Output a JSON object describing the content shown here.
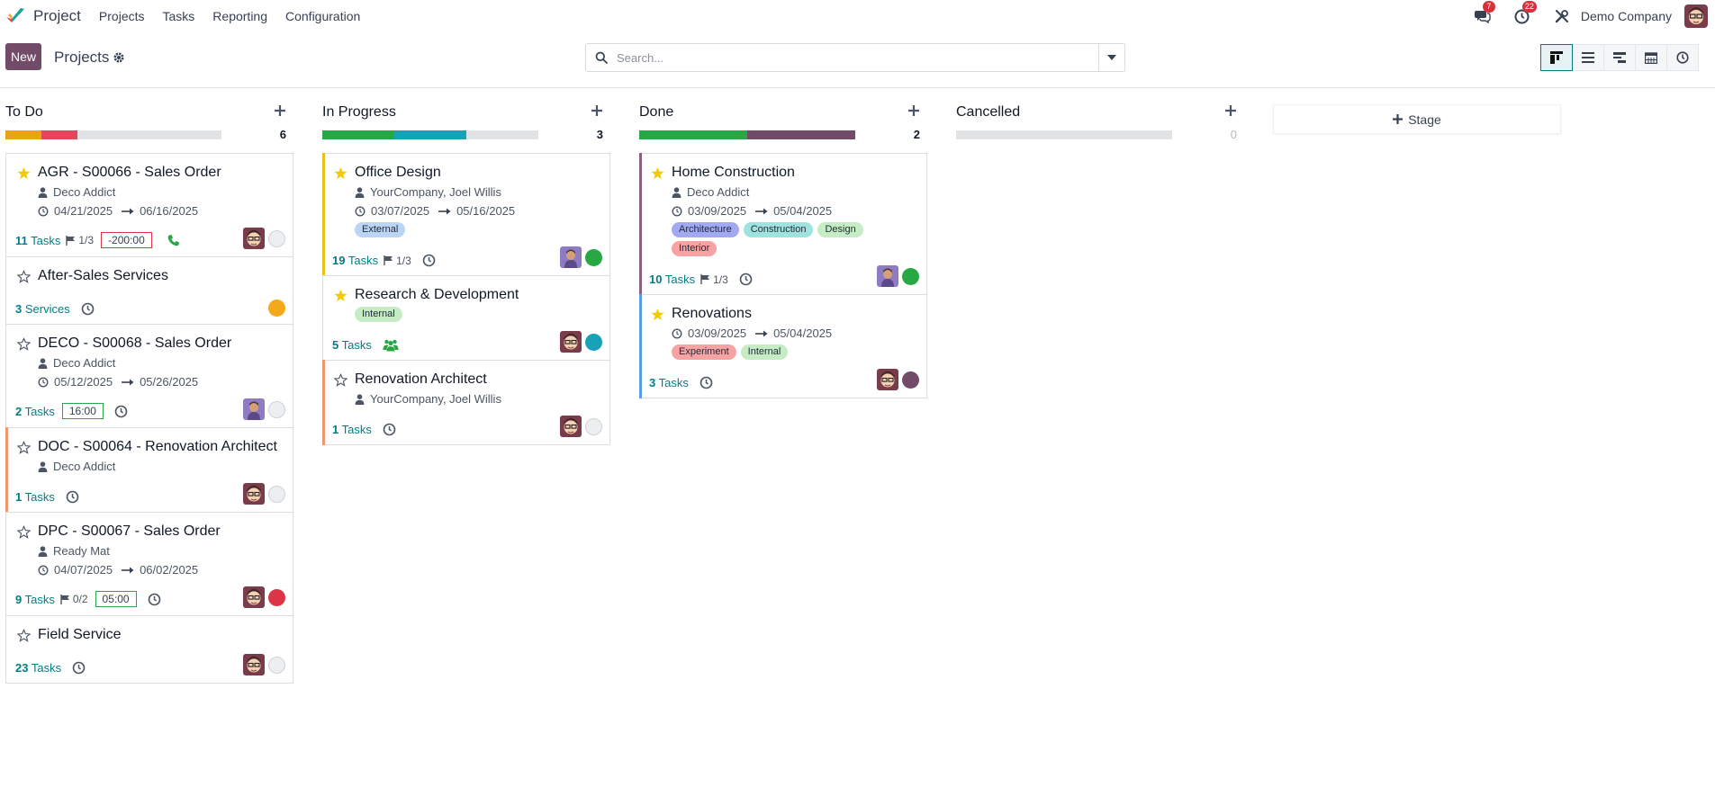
{
  "navbar": {
    "app_name": "Project",
    "menu": [
      "Projects",
      "Tasks",
      "Reporting",
      "Configuration"
    ],
    "messages_badge": "7",
    "activities_badge": "22",
    "company": "Demo Company"
  },
  "control_panel": {
    "new_label": "New",
    "title": "Projects",
    "search_placeholder": "Search..."
  },
  "colors": {
    "brand": "#714b67",
    "accent": "#017e84"
  },
  "columns": [
    {
      "title": "To Do",
      "count": "6",
      "progress": [
        {
          "color": "#e8a317",
          "fraction": 0.167
        },
        {
          "color": "#e4475b",
          "fraction": 0.167
        }
      ],
      "cards": [
        {
          "title": "AGR - S00066 - Sales Order",
          "starred": true,
          "accent": "",
          "partner": "Deco Addict",
          "date_start": "04/21/2025",
          "date_end": "06/16/2025",
          "tags": [],
          "tasks_count": "11",
          "tasks_label": "Tasks",
          "milestone": "1/3",
          "hours": "-200:00",
          "hours_status": "danger",
          "activity_icon": "phone-icon",
          "status": "none"
        },
        {
          "title": "After-Sales Services",
          "starred": false,
          "accent": "",
          "partner": "",
          "date_start": "",
          "date_end": "",
          "tags": [],
          "tasks_count": "3",
          "tasks_label": "Services",
          "milestone": "",
          "hours": "",
          "hours_status": "",
          "activity_icon": "clock-icon",
          "status": "warning",
          "no_avatar": true
        },
        {
          "title": "DECO - S00068 - Sales Order",
          "starred": false,
          "accent": "",
          "partner": "Deco Addict",
          "date_start": "05/12/2025",
          "date_end": "05/26/2025",
          "tags": [],
          "tasks_count": "2",
          "tasks_label": "Tasks",
          "milestone": "",
          "hours": "16:00",
          "hours_status": "success",
          "activity_icon": "clock-icon",
          "status": "none",
          "avatar_kind": "photo"
        },
        {
          "title": "DOC - S00064 - Renovation Architect",
          "starred": false,
          "accent": "#f0976b",
          "partner": "Deco Addict",
          "date_start": "",
          "date_end": "",
          "tags": [],
          "tasks_count": "1",
          "tasks_label": "Tasks",
          "milestone": "",
          "hours": "",
          "hours_status": "",
          "activity_icon": "clock-icon",
          "status": "none"
        },
        {
          "title": "DPC - S00067 - Sales Order",
          "starred": false,
          "accent": "",
          "partner": "Ready Mat",
          "date_start": "04/07/2025",
          "date_end": "06/02/2025",
          "tags": [],
          "tasks_count": "9",
          "tasks_label": "Tasks",
          "milestone": "0/2",
          "hours": "05:00",
          "hours_status": "success",
          "activity_icon": "clock-icon",
          "status": "danger"
        },
        {
          "title": "Field Service",
          "starred": false,
          "accent": "",
          "partner": "",
          "date_start": "",
          "date_end": "",
          "tags": [],
          "tasks_count": "23",
          "tasks_label": "Tasks",
          "milestone": "",
          "hours": "",
          "hours_status": "",
          "activity_icon": "clock-icon",
          "status": "none"
        }
      ]
    },
    {
      "title": "In Progress",
      "count": "3",
      "progress": [
        {
          "color": "#28a745",
          "fraction": 0.333
        },
        {
          "color": "#17a2b8",
          "fraction": 0.333
        }
      ],
      "cards": [
        {
          "title": "Office Design",
          "starred": true,
          "accent": "#e8c317",
          "partner": "YourCompany, Joel Willis",
          "date_start": "03/07/2025",
          "date_end": "05/16/2025",
          "tags": [
            {
              "label": "External",
              "color": "#bcd5f5"
            }
          ],
          "tasks_count": "19",
          "tasks_label": "Tasks",
          "milestone": "1/3",
          "hours": "",
          "hours_status": "",
          "activity_icon": "clock-icon",
          "status": "success",
          "avatar_kind": "photo"
        },
        {
          "title": "Research & Development",
          "starred": true,
          "accent": "",
          "partner": "",
          "date_start": "",
          "date_end": "",
          "tags": [
            {
              "label": "Internal",
              "color": "#c5ecc5"
            }
          ],
          "tasks_count": "5",
          "tasks_label": "Tasks",
          "milestone": "",
          "hours": "",
          "hours_status": "",
          "activity_icon": "users-icon",
          "status": "info"
        },
        {
          "title": "Renovation Architect",
          "starred": false,
          "accent": "#f0976b",
          "partner": "YourCompany, Joel Willis",
          "date_start": "",
          "date_end": "",
          "tags": [],
          "tasks_count": "1",
          "tasks_label": "Tasks",
          "milestone": "",
          "hours": "",
          "hours_status": "",
          "activity_icon": "clock-icon",
          "status": "none"
        }
      ]
    },
    {
      "title": "Done",
      "count": "2",
      "progress": [
        {
          "color": "#28a745",
          "fraction": 0.5
        },
        {
          "color": "#714b67",
          "fraction": 0.5
        }
      ],
      "cards": [
        {
          "title": "Home Construction",
          "starred": true,
          "accent": "#8d5f80",
          "partner": "Deco Addict",
          "date_start": "03/09/2025",
          "date_end": "05/04/2025",
          "tags": [
            {
              "label": "Architecture",
              "color": "#a3a8f3"
            },
            {
              "label": "Construction",
              "color": "#9fe3df"
            },
            {
              "label": "Design",
              "color": "#c5ecc5"
            },
            {
              "label": "Interior",
              "color": "#f7a3a3"
            }
          ],
          "tasks_count": "10",
          "tasks_label": "Tasks",
          "milestone": "1/3",
          "hours": "",
          "hours_status": "",
          "activity_icon": "clock-icon",
          "status": "success",
          "avatar_kind": "photo"
        },
        {
          "title": "Renovations",
          "starred": true,
          "accent": "#5b9ee6",
          "partner": "",
          "date_start": "03/09/2025",
          "date_end": "05/04/2025",
          "tags": [
            {
              "label": "Experiment",
              "color": "#f7a3a3"
            },
            {
              "label": "Internal",
              "color": "#c5ecc5"
            }
          ],
          "tasks_count": "3",
          "tasks_label": "Tasks",
          "milestone": "",
          "hours": "",
          "hours_status": "",
          "activity_icon": "clock-icon",
          "status": "purple"
        }
      ]
    },
    {
      "title": "Cancelled",
      "count": "0",
      "progress": [],
      "cards": []
    }
  ],
  "stage_button": "Stage"
}
